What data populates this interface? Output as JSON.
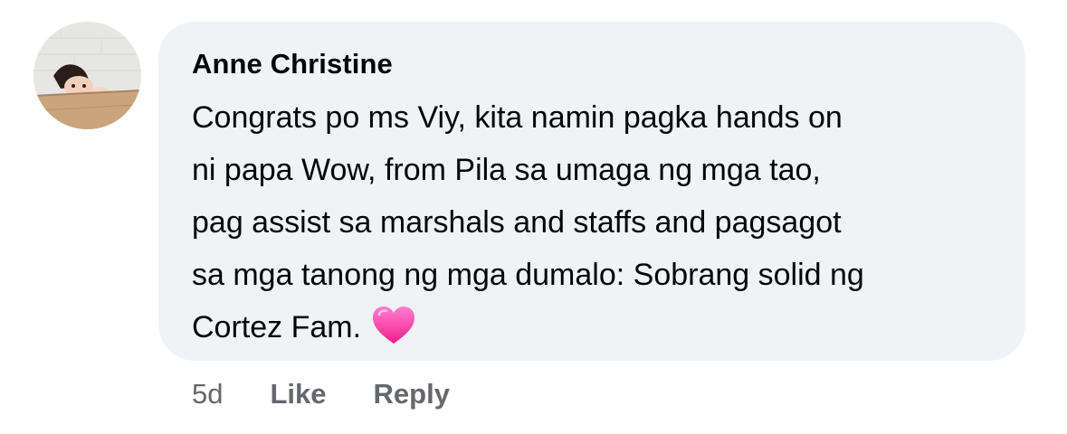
{
  "comment": {
    "author": "Anne Christine",
    "text_lines": [
      "Congrats po ms Viy, kita namin pagka hands on",
      "ni papa Wow, from Pila sa umaga ng mga tao,",
      "pag assist sa marshals and staffs and pagsagot",
      "sa mga tanong ng mga dumalo: Sobrang solid ng",
      "Cortez Fam."
    ],
    "emoji": "pink-heart-icon",
    "timestamp": "5d",
    "like_label": "Like",
    "reply_label": "Reply"
  },
  "colors": {
    "bubble_bg": "#f0f2f5",
    "text": "#050505",
    "meta_text": "#65676b",
    "heart": "#ff3fae"
  }
}
